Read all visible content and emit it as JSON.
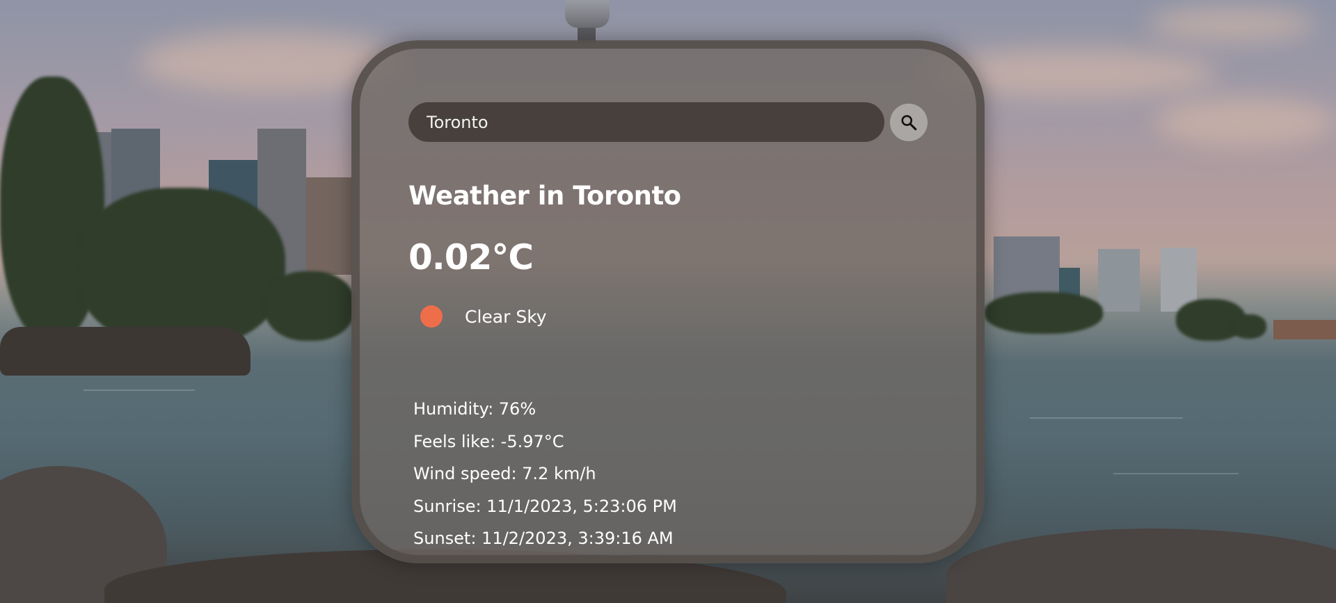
{
  "search": {
    "value": "Toronto",
    "button_icon": "search-icon"
  },
  "weather": {
    "title": "Weather in Toronto",
    "temperature": "0.02°C",
    "condition": {
      "icon": "sun-circle-icon",
      "icon_color": "#ee6e4a",
      "text": "Clear Sky"
    },
    "details": {
      "humidity": "Humidity: 76%",
      "feels_like": "Feels like: -5.97°C",
      "wind_speed": "Wind speed: 7.2 km/h",
      "sunrise": "Sunrise: 11/1/2023, 5:23:06 PM",
      "sunset": "Sunset: 11/2/2023, 3:39:16 AM"
    }
  }
}
